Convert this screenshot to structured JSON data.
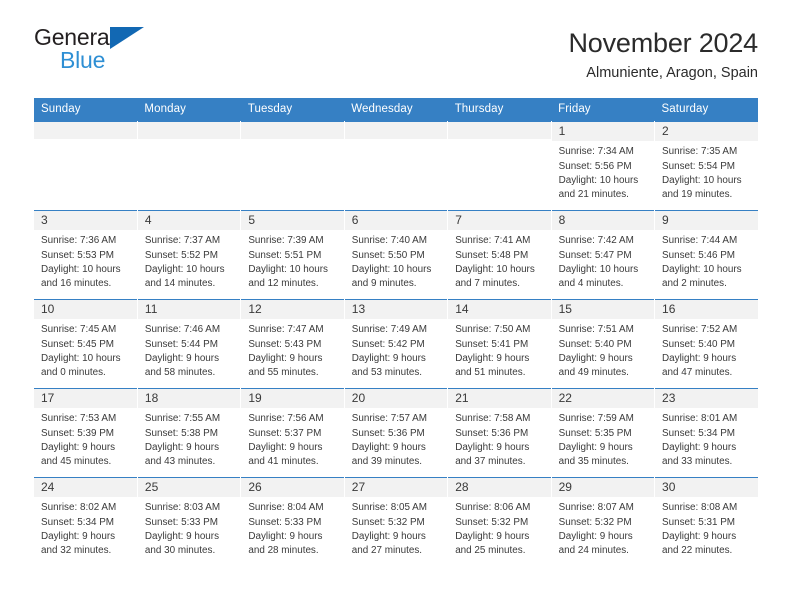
{
  "brand": {
    "name_top": "General",
    "name_bottom": "Blue",
    "triangle_color": "#1268b3",
    "blue_text_color": "#2e8fd4"
  },
  "header": {
    "title": "November 2024",
    "subtitle": "Almuniente, Aragon, Spain"
  },
  "theme": {
    "header_blue": "#3680c4",
    "daynum_band": "#f2f2f2",
    "text": "#3a3a3a"
  },
  "calendar": {
    "weekday_headers": [
      "Sunday",
      "Monday",
      "Tuesday",
      "Wednesday",
      "Thursday",
      "Friday",
      "Saturday"
    ],
    "labels": {
      "sunrise": "Sunrise:",
      "sunset": "Sunset:",
      "daylight": "Daylight:"
    },
    "weeks": [
      [
        {
          "day": "",
          "empty": true
        },
        {
          "day": "",
          "empty": true
        },
        {
          "day": "",
          "empty": true
        },
        {
          "day": "",
          "empty": true
        },
        {
          "day": "",
          "empty": true
        },
        {
          "day": "1",
          "sunrise": "Sunrise: 7:34 AM",
          "sunset": "Sunset: 5:56 PM",
          "daylight_line1": "Daylight: 10 hours",
          "daylight_line2": "and 21 minutes."
        },
        {
          "day": "2",
          "sunrise": "Sunrise: 7:35 AM",
          "sunset": "Sunset: 5:54 PM",
          "daylight_line1": "Daylight: 10 hours",
          "daylight_line2": "and 19 minutes."
        }
      ],
      [
        {
          "day": "3",
          "sunrise": "Sunrise: 7:36 AM",
          "sunset": "Sunset: 5:53 PM",
          "daylight_line1": "Daylight: 10 hours",
          "daylight_line2": "and 16 minutes."
        },
        {
          "day": "4",
          "sunrise": "Sunrise: 7:37 AM",
          "sunset": "Sunset: 5:52 PM",
          "daylight_line1": "Daylight: 10 hours",
          "daylight_line2": "and 14 minutes."
        },
        {
          "day": "5",
          "sunrise": "Sunrise: 7:39 AM",
          "sunset": "Sunset: 5:51 PM",
          "daylight_line1": "Daylight: 10 hours",
          "daylight_line2": "and 12 minutes."
        },
        {
          "day": "6",
          "sunrise": "Sunrise: 7:40 AM",
          "sunset": "Sunset: 5:50 PM",
          "daylight_line1": "Daylight: 10 hours",
          "daylight_line2": "and 9 minutes."
        },
        {
          "day": "7",
          "sunrise": "Sunrise: 7:41 AM",
          "sunset": "Sunset: 5:48 PM",
          "daylight_line1": "Daylight: 10 hours",
          "daylight_line2": "and 7 minutes."
        },
        {
          "day": "8",
          "sunrise": "Sunrise: 7:42 AM",
          "sunset": "Sunset: 5:47 PM",
          "daylight_line1": "Daylight: 10 hours",
          "daylight_line2": "and 4 minutes."
        },
        {
          "day": "9",
          "sunrise": "Sunrise: 7:44 AM",
          "sunset": "Sunset: 5:46 PM",
          "daylight_line1": "Daylight: 10 hours",
          "daylight_line2": "and 2 minutes."
        }
      ],
      [
        {
          "day": "10",
          "sunrise": "Sunrise: 7:45 AM",
          "sunset": "Sunset: 5:45 PM",
          "daylight_line1": "Daylight: 10 hours",
          "daylight_line2": "and 0 minutes."
        },
        {
          "day": "11",
          "sunrise": "Sunrise: 7:46 AM",
          "sunset": "Sunset: 5:44 PM",
          "daylight_line1": "Daylight: 9 hours",
          "daylight_line2": "and 58 minutes."
        },
        {
          "day": "12",
          "sunrise": "Sunrise: 7:47 AM",
          "sunset": "Sunset: 5:43 PM",
          "daylight_line1": "Daylight: 9 hours",
          "daylight_line2": "and 55 minutes."
        },
        {
          "day": "13",
          "sunrise": "Sunrise: 7:49 AM",
          "sunset": "Sunset: 5:42 PM",
          "daylight_line1": "Daylight: 9 hours",
          "daylight_line2": "and 53 minutes."
        },
        {
          "day": "14",
          "sunrise": "Sunrise: 7:50 AM",
          "sunset": "Sunset: 5:41 PM",
          "daylight_line1": "Daylight: 9 hours",
          "daylight_line2": "and 51 minutes."
        },
        {
          "day": "15",
          "sunrise": "Sunrise: 7:51 AM",
          "sunset": "Sunset: 5:40 PM",
          "daylight_line1": "Daylight: 9 hours",
          "daylight_line2": "and 49 minutes."
        },
        {
          "day": "16",
          "sunrise": "Sunrise: 7:52 AM",
          "sunset": "Sunset: 5:40 PM",
          "daylight_line1": "Daylight: 9 hours",
          "daylight_line2": "and 47 minutes."
        }
      ],
      [
        {
          "day": "17",
          "sunrise": "Sunrise: 7:53 AM",
          "sunset": "Sunset: 5:39 PM",
          "daylight_line1": "Daylight: 9 hours",
          "daylight_line2": "and 45 minutes."
        },
        {
          "day": "18",
          "sunrise": "Sunrise: 7:55 AM",
          "sunset": "Sunset: 5:38 PM",
          "daylight_line1": "Daylight: 9 hours",
          "daylight_line2": "and 43 minutes."
        },
        {
          "day": "19",
          "sunrise": "Sunrise: 7:56 AM",
          "sunset": "Sunset: 5:37 PM",
          "daylight_line1": "Daylight: 9 hours",
          "daylight_line2": "and 41 minutes."
        },
        {
          "day": "20",
          "sunrise": "Sunrise: 7:57 AM",
          "sunset": "Sunset: 5:36 PM",
          "daylight_line1": "Daylight: 9 hours",
          "daylight_line2": "and 39 minutes."
        },
        {
          "day": "21",
          "sunrise": "Sunrise: 7:58 AM",
          "sunset": "Sunset: 5:36 PM",
          "daylight_line1": "Daylight: 9 hours",
          "daylight_line2": "and 37 minutes."
        },
        {
          "day": "22",
          "sunrise": "Sunrise: 7:59 AM",
          "sunset": "Sunset: 5:35 PM",
          "daylight_line1": "Daylight: 9 hours",
          "daylight_line2": "and 35 minutes."
        },
        {
          "day": "23",
          "sunrise": "Sunrise: 8:01 AM",
          "sunset": "Sunset: 5:34 PM",
          "daylight_line1": "Daylight: 9 hours",
          "daylight_line2": "and 33 minutes."
        }
      ],
      [
        {
          "day": "24",
          "sunrise": "Sunrise: 8:02 AM",
          "sunset": "Sunset: 5:34 PM",
          "daylight_line1": "Daylight: 9 hours",
          "daylight_line2": "and 32 minutes."
        },
        {
          "day": "25",
          "sunrise": "Sunrise: 8:03 AM",
          "sunset": "Sunset: 5:33 PM",
          "daylight_line1": "Daylight: 9 hours",
          "daylight_line2": "and 30 minutes."
        },
        {
          "day": "26",
          "sunrise": "Sunrise: 8:04 AM",
          "sunset": "Sunset: 5:33 PM",
          "daylight_line1": "Daylight: 9 hours",
          "daylight_line2": "and 28 minutes."
        },
        {
          "day": "27",
          "sunrise": "Sunrise: 8:05 AM",
          "sunset": "Sunset: 5:32 PM",
          "daylight_line1": "Daylight: 9 hours",
          "daylight_line2": "and 27 minutes."
        },
        {
          "day": "28",
          "sunrise": "Sunrise: 8:06 AM",
          "sunset": "Sunset: 5:32 PM",
          "daylight_line1": "Daylight: 9 hours",
          "daylight_line2": "and 25 minutes."
        },
        {
          "day": "29",
          "sunrise": "Sunrise: 8:07 AM",
          "sunset": "Sunset: 5:32 PM",
          "daylight_line1": "Daylight: 9 hours",
          "daylight_line2": "and 24 minutes."
        },
        {
          "day": "30",
          "sunrise": "Sunrise: 8:08 AM",
          "sunset": "Sunset: 5:31 PM",
          "daylight_line1": "Daylight: 9 hours",
          "daylight_line2": "and 22 minutes."
        }
      ]
    ]
  }
}
